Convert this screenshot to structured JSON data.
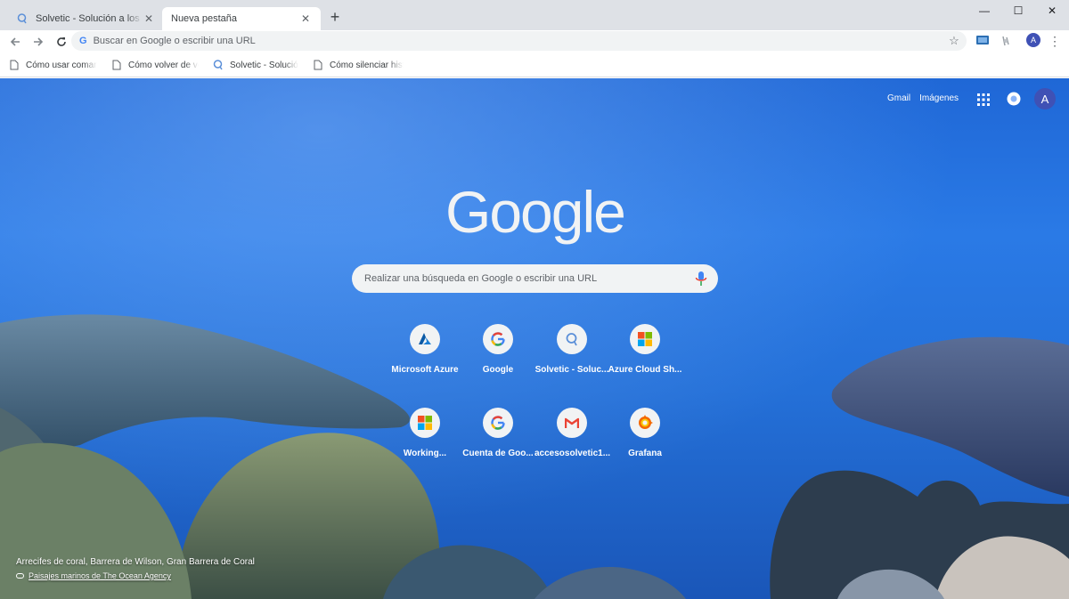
{
  "window": {
    "tabs": [
      {
        "title": "Solvetic - Solución a los problemas",
        "icon": "solvetic-icon",
        "active": false
      },
      {
        "title": "Nueva pestaña",
        "icon": "",
        "active": true
      }
    ],
    "controls": {
      "minimize": "—",
      "maximize": "☐",
      "close": "✕"
    }
  },
  "toolbar": {
    "omnibox_placeholder": "Buscar en Google o escribir una URL",
    "avatar_letter": "A"
  },
  "bookmarks": [
    {
      "label": "Cómo usar comandos",
      "icon": "page-icon"
    },
    {
      "label": "Cómo volver de versión",
      "icon": "page-icon"
    },
    {
      "label": "Solvetic - Solución a",
      "icon": "solvetic-icon"
    },
    {
      "label": "Cómo silenciar historias",
      "icon": "page-icon"
    }
  ],
  "ntp": {
    "top_links": {
      "gmail": "Gmail",
      "images": "Imágenes"
    },
    "avatar_letter": "A",
    "logo_text": "Google",
    "search_placeholder": "Realizar una búsqueda en Google o escribir una URL",
    "shortcuts": [
      {
        "label": "Microsoft Azure",
        "icon": "azure-icon"
      },
      {
        "label": "Google",
        "icon": "google-g-icon"
      },
      {
        "label": "Solvetic - Soluc...",
        "icon": "solvetic-icon"
      },
      {
        "label": "Azure Cloud Sh...",
        "icon": "windows-icon"
      },
      {
        "label": "Working...",
        "icon": "windows-icon"
      },
      {
        "label": "Cuenta de Goo...",
        "icon": "google-g-icon"
      },
      {
        "label": "accesosolvetic1...",
        "icon": "gmail-icon"
      },
      {
        "label": "Grafana",
        "icon": "grafana-icon"
      }
    ],
    "caption_title": "Arrecifes de coral, Barrera de Wilson, Gran Barrera de Coral",
    "caption_credit": "Paisajes marinos de The Ocean Agency"
  },
  "colors": {
    "tabstrip": "#dee1e6",
    "omnibox": "#f1f3f4",
    "sea": "#2470d8",
    "avatar": "#3f51b5"
  }
}
